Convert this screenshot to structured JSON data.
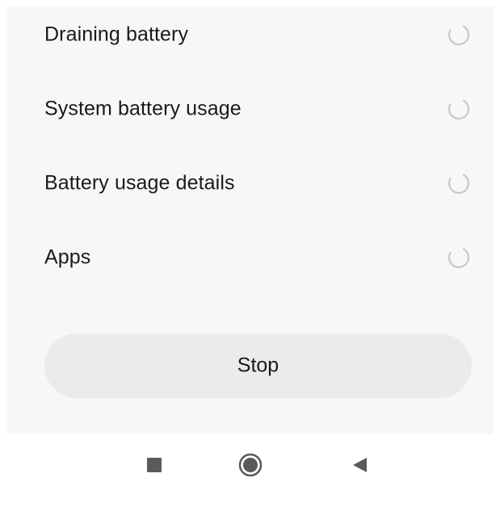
{
  "scan_items": [
    {
      "label": "Draining battery",
      "icon": "loading-spinner-icon"
    },
    {
      "label": "System battery usage",
      "icon": "loading-spinner-icon"
    },
    {
      "label": "Battery usage details",
      "icon": "loading-spinner-icon"
    },
    {
      "label": "Apps",
      "icon": "loading-spinner-icon"
    }
  ],
  "stop_button": {
    "label": "Stop"
  },
  "nav_bar": {
    "recents_icon": "square-icon",
    "home_icon": "circle-icon",
    "back_icon": "triangle-back-icon"
  },
  "colors": {
    "panel_background": "#f7f7f7",
    "button_background": "#ebebeb",
    "text": "#1a1a1a",
    "nav_icon": "#5a5a5a",
    "spinner": "#c8c8c8"
  }
}
